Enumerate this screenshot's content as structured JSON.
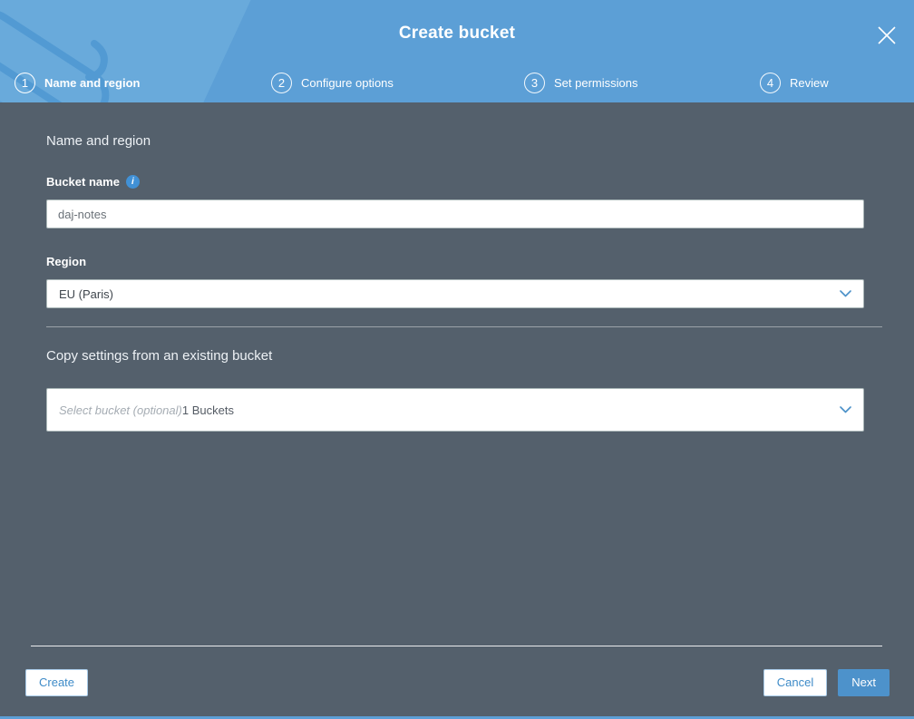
{
  "modal": {
    "title": "Create bucket",
    "close_icon": "x-icon"
  },
  "steps": [
    {
      "num": "1",
      "label": "Name and region",
      "active": true
    },
    {
      "num": "2",
      "label": "Configure options",
      "active": false
    },
    {
      "num": "3",
      "label": "Set permissions",
      "active": false
    },
    {
      "num": "4",
      "label": "Review",
      "active": false
    }
  ],
  "form": {
    "section_heading": "Name and region",
    "bucket_name": {
      "label": "Bucket name",
      "info_icon": "i",
      "value": "daj-notes"
    },
    "region": {
      "label": "Region",
      "selected_value": "EU (Paris)"
    },
    "copy_settings": {
      "heading": "Copy settings from an existing bucket",
      "placeholder": "Select bucket (optional)",
      "suffix": "1 Buckets"
    }
  },
  "footer": {
    "create_label": "Create",
    "cancel_label": "Cancel",
    "next_label": "Next"
  },
  "colors": {
    "header_blue": "#5C9FD6",
    "body_background": "#54606C",
    "accent_blue": "#4A90C8",
    "primary_button_blue": "#4D92CB",
    "button_text_blue": "#3E8BC8"
  }
}
